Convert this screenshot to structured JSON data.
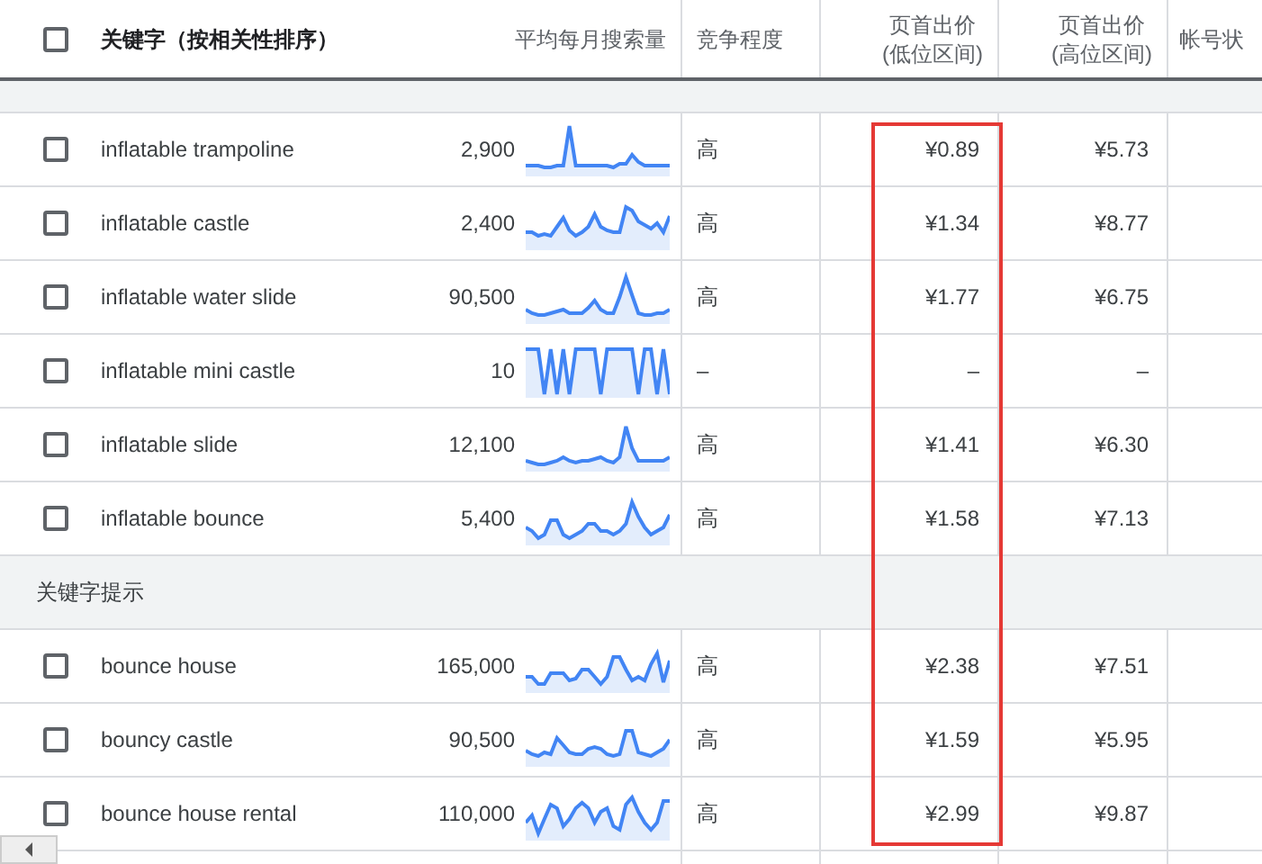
{
  "header": {
    "select_all_checked": false,
    "columns": [
      {
        "label": "关键字（按相关性排序）"
      },
      {
        "label": "平均每月搜索量"
      },
      {
        "label": "竞争程度"
      },
      {
        "label": "页首出价\n(低位区间)"
      },
      {
        "label": "页首出价\n(高位区间)"
      },
      {
        "label": "帐号状"
      }
    ]
  },
  "groups": [
    {
      "rows": [
        {
          "keyword": "inflatable trampoline",
          "volume": "2,900",
          "competition": "高",
          "low_bid": "¥0.89",
          "high_bid": "¥5.73",
          "checked": false
        },
        {
          "keyword": "inflatable castle",
          "volume": "2,400",
          "competition": "高",
          "low_bid": "¥1.34",
          "high_bid": "¥8.77",
          "checked": false
        },
        {
          "keyword": "inflatable water slide",
          "volume": "90,500",
          "competition": "高",
          "low_bid": "¥1.77",
          "high_bid": "¥6.75",
          "checked": false
        },
        {
          "keyword": "inflatable mini castle",
          "volume": "10",
          "competition": "–",
          "low_bid": "–",
          "high_bid": "–",
          "checked": false
        },
        {
          "keyword": "inflatable slide",
          "volume": "12,100",
          "competition": "高",
          "low_bid": "¥1.41",
          "high_bid": "¥6.30",
          "checked": false
        },
        {
          "keyword": "inflatable bounce",
          "volume": "5,400",
          "competition": "高",
          "low_bid": "¥1.58",
          "high_bid": "¥7.13",
          "checked": false
        }
      ]
    },
    {
      "title": "关键字提示",
      "rows": [
        {
          "keyword": "bounce house",
          "volume": "165,000",
          "competition": "高",
          "low_bid": "¥2.38",
          "high_bid": "¥7.51",
          "checked": false
        },
        {
          "keyword": "bouncy castle",
          "volume": "90,500",
          "competition": "高",
          "low_bid": "¥1.59",
          "high_bid": "¥5.95",
          "checked": false
        },
        {
          "keyword": "bounce house rental",
          "volume": "110,000",
          "competition": "高",
          "low_bid": "¥2.99",
          "high_bid": "¥9.87",
          "checked": false
        }
      ]
    }
  ]
}
